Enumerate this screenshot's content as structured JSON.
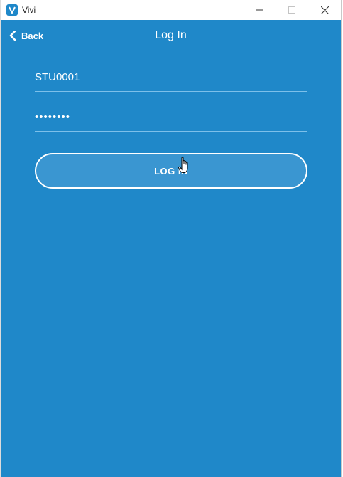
{
  "window": {
    "title": "Vivi",
    "logo_icon": "vivi-logo-icon",
    "controls": [
      "minimize-icon",
      "maximize-icon",
      "close-icon"
    ]
  },
  "header": {
    "back_label": "Back",
    "title": "Log In"
  },
  "form": {
    "username_value": "STU0001",
    "password_value": "password"
  },
  "login_button": {
    "label": "LOG IN"
  },
  "colors": {
    "background": "#1f88c9",
    "button_fill": "#3a96d1",
    "text": "#ffffff"
  }
}
